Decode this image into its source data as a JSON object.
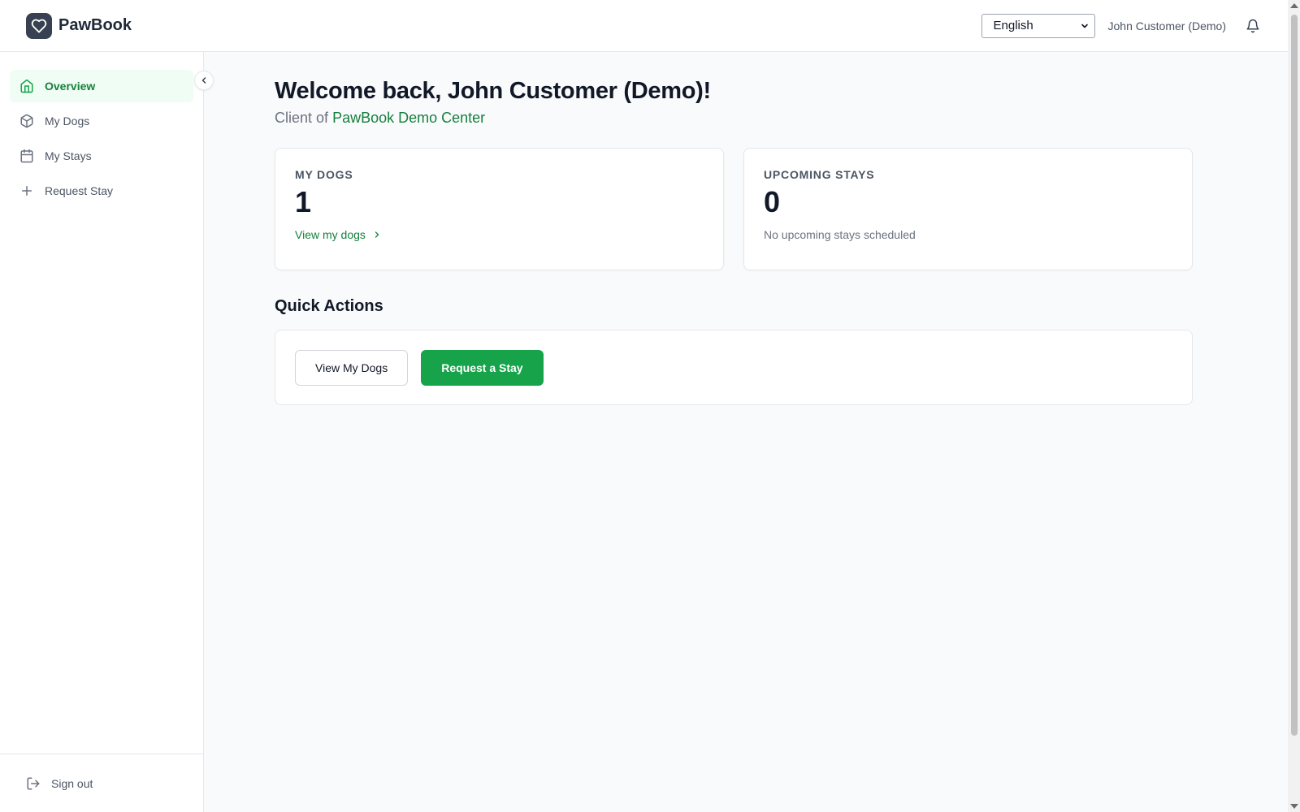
{
  "brand": {
    "name": "PawBook",
    "logo_icon": "heart-icon"
  },
  "header": {
    "language": {
      "selected": "English"
    },
    "user_name": "John Customer (Demo)",
    "notifications_icon": "bell-icon"
  },
  "sidebar": {
    "items": [
      {
        "label": "Overview",
        "icon": "home-icon",
        "active": true
      },
      {
        "label": "My Dogs",
        "icon": "box-icon",
        "active": false
      },
      {
        "label": "My Stays",
        "icon": "calendar-icon",
        "active": false
      },
      {
        "label": "Request Stay",
        "icon": "plus-icon",
        "active": false
      }
    ],
    "sign_out": "Sign out"
  },
  "main": {
    "welcome": "Welcome back, John Customer (Demo)!",
    "subtitle_prefix": "Client of",
    "center_name": "PawBook Demo Center",
    "cards": {
      "dogs": {
        "label": "MY DOGS",
        "value": "1",
        "link": "View my dogs"
      },
      "stays": {
        "label": "UPCOMING STAYS",
        "value": "0",
        "note": "No upcoming stays scheduled"
      }
    },
    "quick_actions": {
      "title": "Quick Actions",
      "view_dogs": "View My Dogs",
      "request_stay": "Request a Stay"
    }
  },
  "colors": {
    "accent": "#16a34a",
    "accent_text": "#15803d",
    "active_bg": "#f0fdf4",
    "logo_bg": "#374151"
  }
}
